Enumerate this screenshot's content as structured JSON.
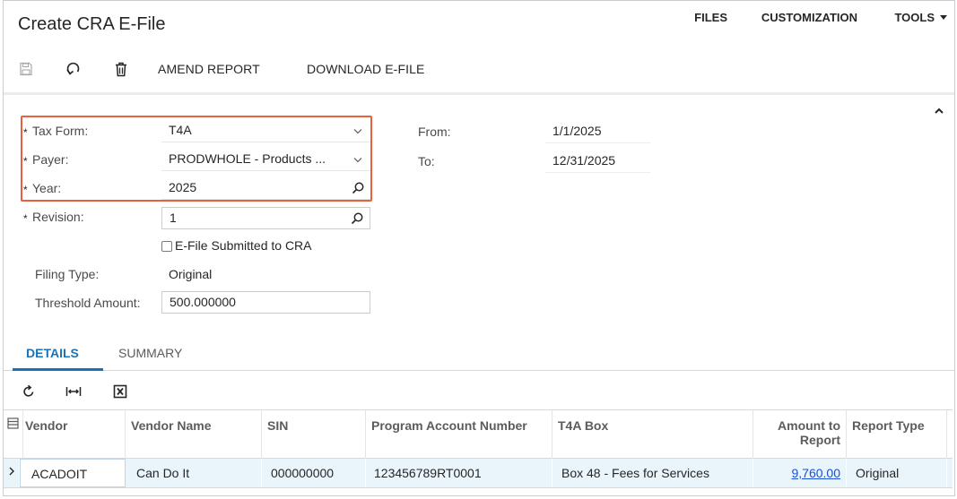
{
  "header": {
    "title": "Create CRA E-File",
    "links": {
      "files": "FILES",
      "customization": "CUSTOMIZATION",
      "tools": "TOOLS"
    }
  },
  "toolbar": {
    "icons": [
      "save-icon",
      "undo-icon",
      "delete-icon"
    ],
    "amend_report": "AMEND REPORT",
    "download_efile": "DOWNLOAD E-FILE"
  },
  "form": {
    "required_mark": "*",
    "tax_form": {
      "label": "Tax Form:",
      "value": "T4A"
    },
    "payer": {
      "label": "Payer:",
      "value": "PRODWHOLE - Products ..."
    },
    "year": {
      "label": "Year:",
      "value": "2025"
    },
    "revision": {
      "label": "Revision:",
      "value": "1"
    },
    "efile_submitted": {
      "label": "E-File Submitted to CRA",
      "checked": false
    },
    "filing_type": {
      "label": "Filing Type:",
      "value": "Original"
    },
    "threshold_amount": {
      "label": "Threshold Amount:",
      "value": "500.000000"
    },
    "from": {
      "label": "From:",
      "value": "1/1/2025"
    },
    "to": {
      "label": "To:",
      "value": "12/31/2025"
    }
  },
  "tabs": [
    {
      "label": "DETAILS",
      "active": true
    },
    {
      "label": "SUMMARY",
      "active": false
    }
  ],
  "grid_toolbar": [
    "refresh-icon",
    "fit-columns-icon",
    "export-excel-icon"
  ],
  "grid": {
    "columns": [
      "Vendor",
      "Vendor Name",
      "SIN",
      "Program Account Number",
      "T4A Box",
      "Amount to Report",
      "Report Type"
    ],
    "rows": [
      {
        "vendor": "ACADOIT",
        "vendor_name": "Can Do It",
        "sin": "000000000",
        "program_account_number": "123456789RT0001",
        "t4a_box": "Box 48 - Fees for Services",
        "amount_to_report": "9,760.00",
        "report_type": "Original"
      }
    ]
  },
  "colors": {
    "accent": "#1a73b8",
    "highlight": "#e8603c",
    "link": "#1a4fd6",
    "row_selected": "#eaf4fb"
  }
}
